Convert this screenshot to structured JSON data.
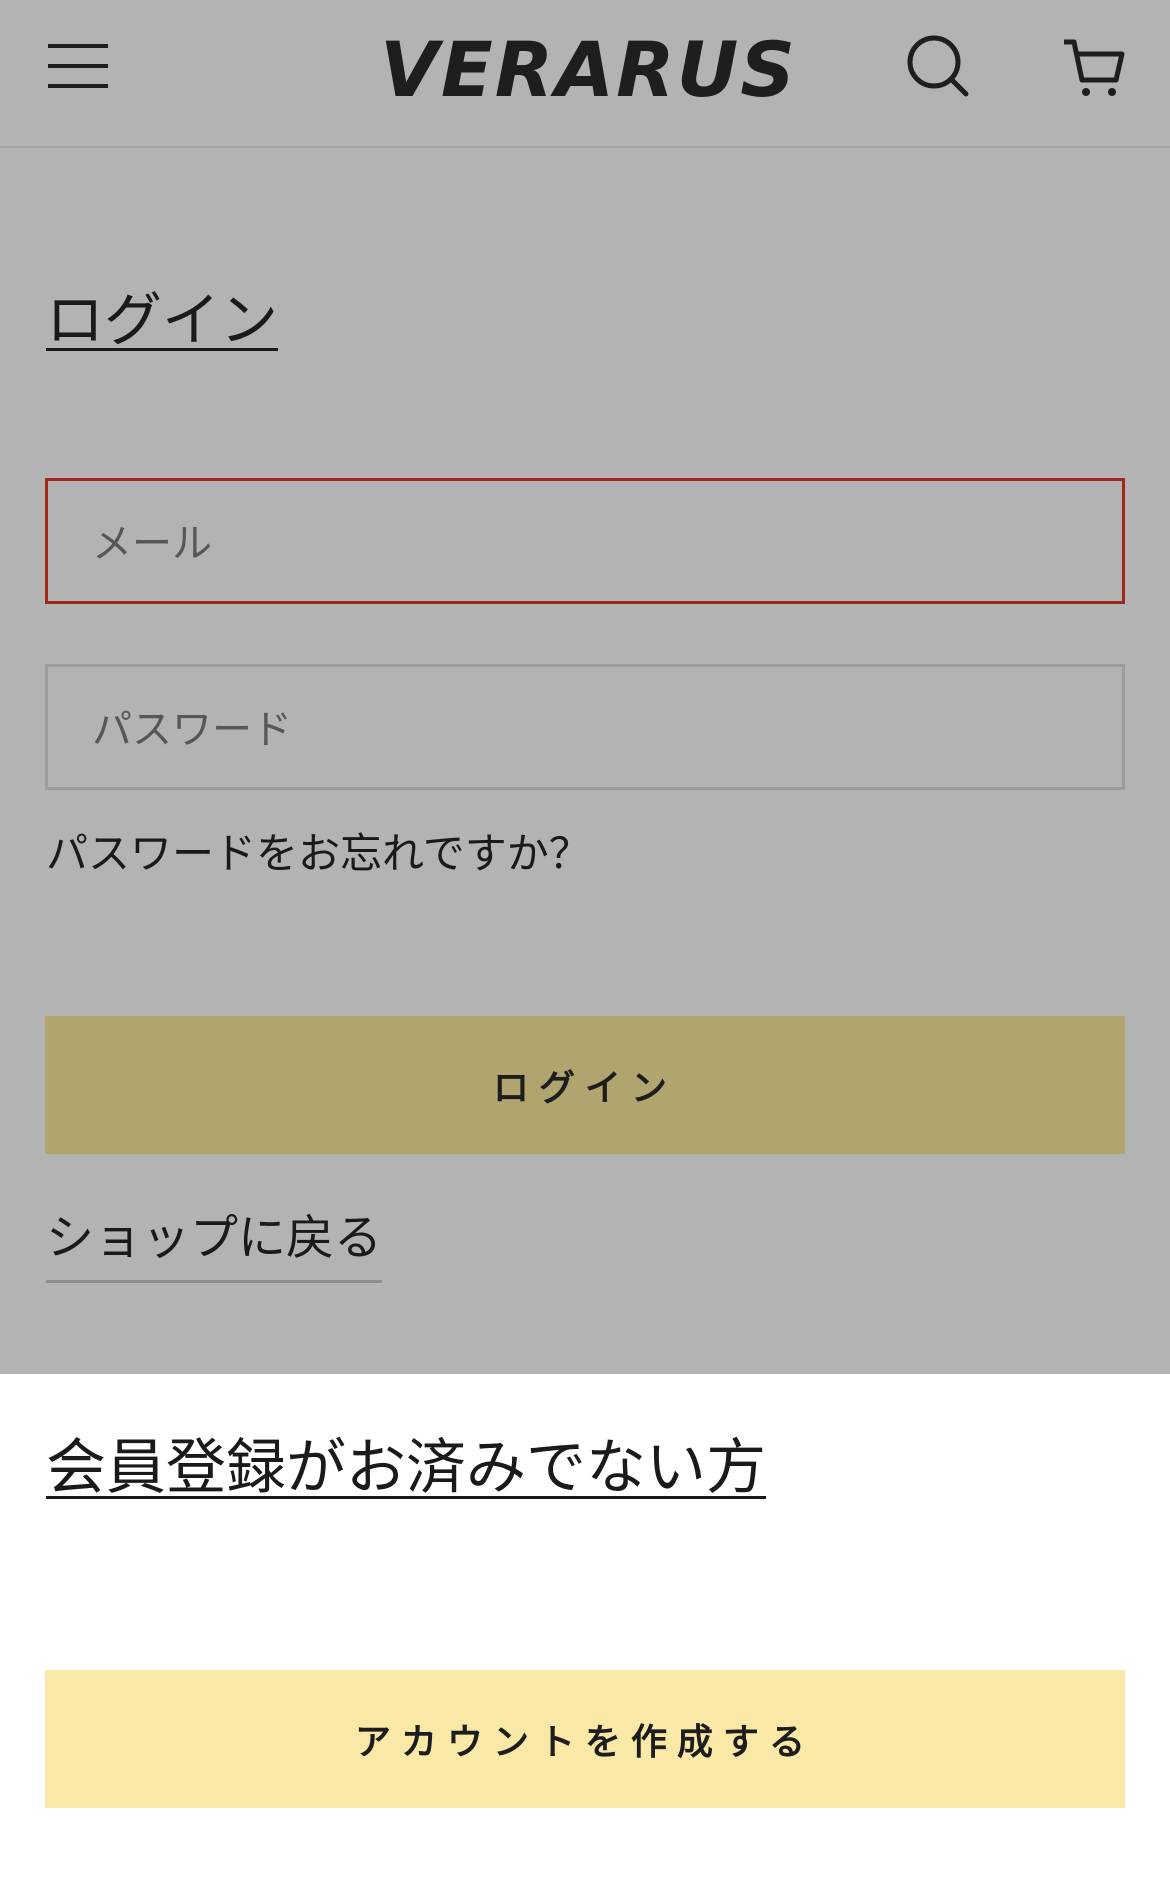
{
  "header": {
    "logo": "VERARUS",
    "menu_icon": "hamburger-menu-icon",
    "search_icon": "search-icon",
    "cart_icon": "cart-icon"
  },
  "login": {
    "title": "ログイン",
    "email_placeholder": "メール",
    "email_value": "",
    "password_placeholder": "パスワード",
    "password_value": "",
    "forgot_password": "パスワードをお忘れですか？",
    "submit_label": "ログイン",
    "back_to_shop": "ショップに戻る"
  },
  "register": {
    "title": "会員登録がお済みでない方",
    "create_account_label": "アカウントを作成する"
  },
  "colors": {
    "overlay_gray": "#b3b3b3",
    "email_error_border": "#a0271c",
    "login_button": "#b0a46f",
    "create_button": "#fae8a6"
  }
}
